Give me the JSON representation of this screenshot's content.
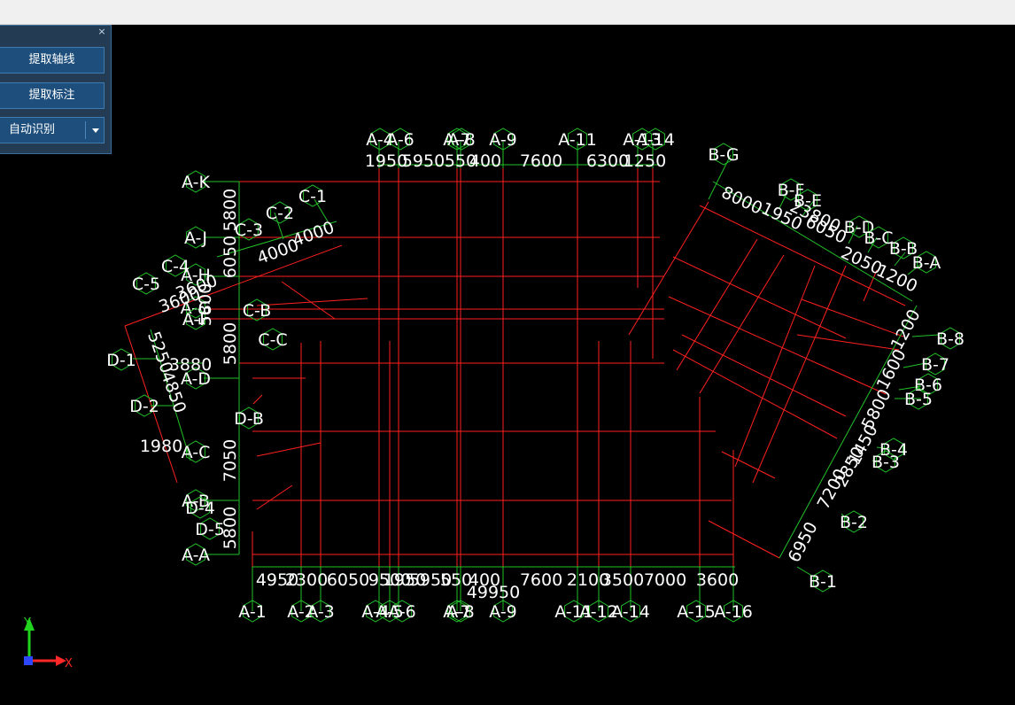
{
  "panel": {
    "close_glyph": "×",
    "buttons": [
      "提取轴线",
      "提取标注"
    ],
    "mode_select": "自动识别"
  },
  "colors": {
    "axis_line": "#ff2020",
    "dim_line": "#22c22a",
    "label_text": "#ffffff",
    "background": "#000000"
  },
  "coordinate_icon": {
    "x_label": "X",
    "y_label": "Y"
  },
  "drawing": {
    "bubbles": [
      {
        "text": "A-K"
      },
      {
        "text": "A-J"
      },
      {
        "text": "A-H"
      },
      {
        "text": "A-G"
      },
      {
        "text": "A-F"
      },
      {
        "text": "A-D"
      },
      {
        "text": "A-C"
      },
      {
        "text": "A-B"
      },
      {
        "text": "A-A"
      },
      {
        "text": "A-1"
      },
      {
        "text": "A-2"
      },
      {
        "text": "A-3"
      },
      {
        "text": "A-4"
      },
      {
        "text": "A-5"
      },
      {
        "text": "A-6"
      },
      {
        "text": "A-7"
      },
      {
        "text": "A-8"
      },
      {
        "text": "A-9"
      },
      {
        "text": "A-11"
      },
      {
        "text": "A-12"
      },
      {
        "text": "A-14"
      },
      {
        "text": "A-15"
      },
      {
        "text": "A-16"
      },
      {
        "text": "A-4"
      },
      {
        "text": "A-6"
      },
      {
        "text": "A-7"
      },
      {
        "text": "A-8"
      },
      {
        "text": "A-9"
      },
      {
        "text": "A-11"
      },
      {
        "text": "A-13"
      },
      {
        "text": "A-14"
      },
      {
        "text": "C-1"
      },
      {
        "text": "C-2"
      },
      {
        "text": "C-3"
      },
      {
        "text": "C-4"
      },
      {
        "text": "C-5"
      },
      {
        "text": "C-B"
      },
      {
        "text": "C-C"
      },
      {
        "text": "D-1"
      },
      {
        "text": "D-2"
      },
      {
        "text": "D-B"
      },
      {
        "text": "D-4"
      },
      {
        "text": "D-5"
      },
      {
        "text": "B-G"
      },
      {
        "text": "B-F"
      },
      {
        "text": "B-E"
      },
      {
        "text": "B-D"
      },
      {
        "text": "B-C"
      },
      {
        "text": "B-B"
      },
      {
        "text": "B-A"
      },
      {
        "text": "B-8"
      },
      {
        "text": "B-7"
      },
      {
        "text": "B-6"
      },
      {
        "text": "B-5"
      },
      {
        "text": "B-4"
      },
      {
        "text": "B-3"
      },
      {
        "text": "B-2"
      },
      {
        "text": "B-1"
      }
    ],
    "dimensions": [
      {
        "text": "1950"
      },
      {
        "text": "5950"
      },
      {
        "text": "550"
      },
      {
        "text": "400"
      },
      {
        "text": "7600"
      },
      {
        "text": "6300"
      },
      {
        "text": "1250"
      },
      {
        "text": "4950"
      },
      {
        "text": "2300"
      },
      {
        "text": "6050"
      },
      {
        "text": "9500"
      },
      {
        "text": "1950"
      },
      {
        "text": "5950"
      },
      {
        "text": "550"
      },
      {
        "text": "400"
      },
      {
        "text": "7600"
      },
      {
        "text": "2100"
      },
      {
        "text": "3500"
      },
      {
        "text": "7000"
      },
      {
        "text": "3600"
      },
      {
        "text": "49950"
      },
      {
        "text": "5800"
      },
      {
        "text": "6050"
      },
      {
        "text": "5800"
      },
      {
        "text": "5800"
      },
      {
        "text": "4000"
      },
      {
        "text": "4000"
      },
      {
        "text": "3600"
      },
      {
        "text": "3600"
      },
      {
        "text": "5800"
      },
      {
        "text": "3880"
      },
      {
        "text": "5250"
      },
      {
        "text": "4850"
      },
      {
        "text": "1980"
      },
      {
        "text": "7050"
      },
      {
        "text": "8000"
      },
      {
        "text": "1950"
      },
      {
        "text": "6050"
      },
      {
        "text": "23800"
      },
      {
        "text": "2050"
      },
      {
        "text": "1200"
      },
      {
        "text": "1200"
      },
      {
        "text": "1600"
      },
      {
        "text": "5800"
      },
      {
        "text": "1450"
      },
      {
        "text": "2850"
      },
      {
        "text": "7200"
      },
      {
        "text": "6950"
      }
    ]
  }
}
